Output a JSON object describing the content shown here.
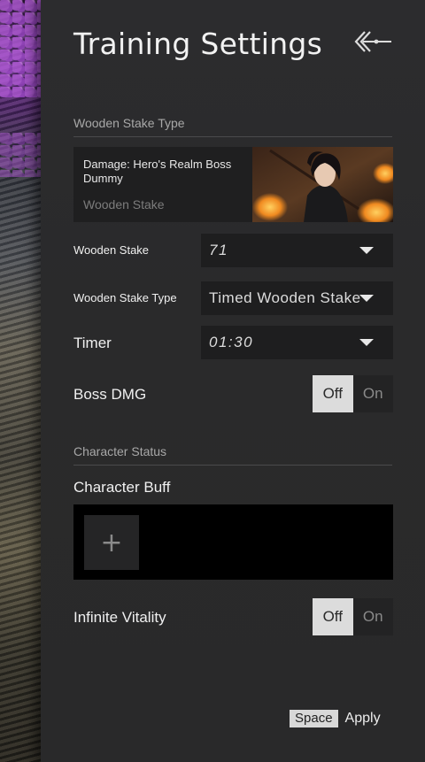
{
  "header": {
    "title": "Training Settings"
  },
  "stake_section": {
    "label": "Wooden Stake Type",
    "card": {
      "damage_text": "Damage: Hero's Realm Boss Dummy",
      "name": "Wooden Stake"
    }
  },
  "settings": {
    "wooden_stake": {
      "label": "Wooden Stake",
      "value": "71"
    },
    "wooden_stake_type": {
      "label": "Wooden Stake Type",
      "value": "Timed Wooden Stake"
    },
    "timer": {
      "label": "Timer",
      "value": "01:30"
    },
    "boss_dmg": {
      "label": "Boss DMG",
      "off": "Off",
      "on": "On",
      "selected": "Off"
    }
  },
  "character_section": {
    "label": "Character Status",
    "buff_label": "Character Buff",
    "add_glyph": "+",
    "infinite_vitality": {
      "label": "Infinite Vitality",
      "off": "Off",
      "on": "On",
      "selected": "Off"
    }
  },
  "footer": {
    "key": "Space",
    "apply_label": "Apply"
  },
  "colors": {
    "panel_bg": "#2b2b2c",
    "toggle_active": "#dcdcdc",
    "scene_purple": "#7a3fa0"
  },
  "icons": {
    "back": "back-arrow-icon",
    "caret": "chevron-down-icon",
    "add": "plus-icon"
  }
}
